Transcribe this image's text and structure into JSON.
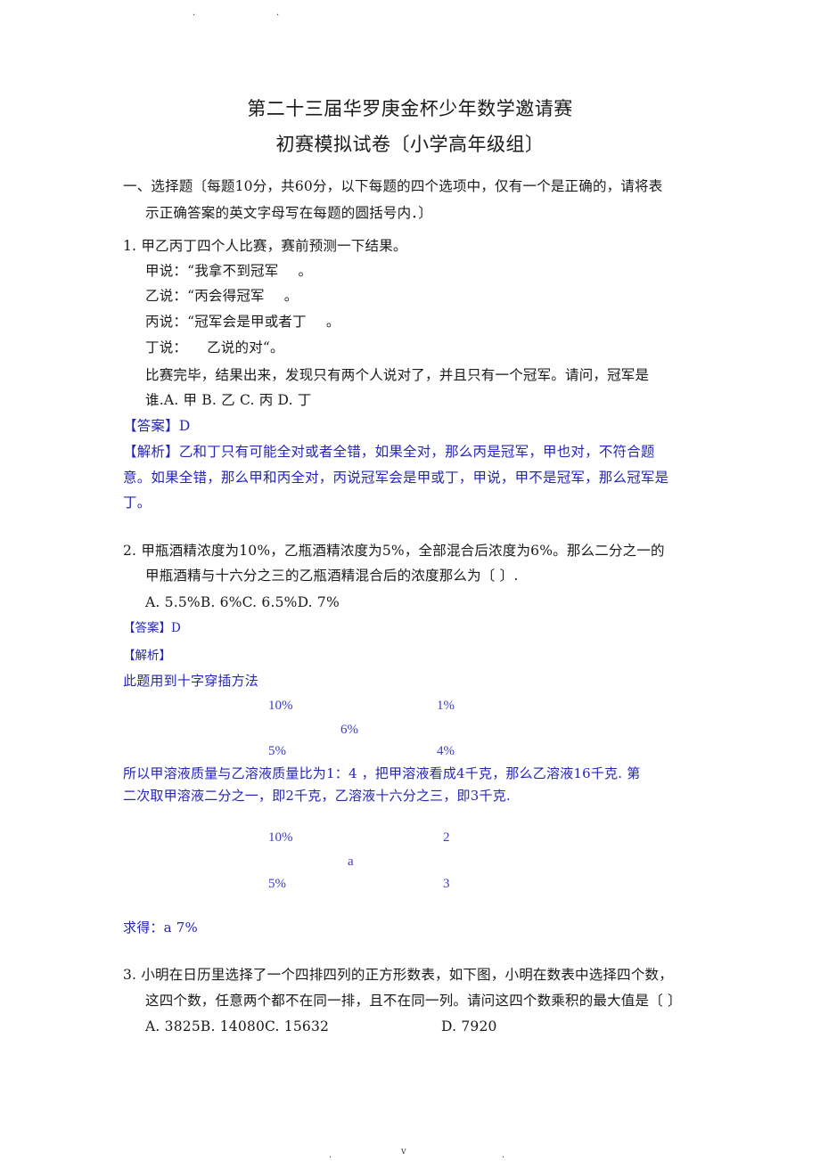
{
  "page_marks": {
    "top": [
      ".",
      "."
    ],
    "bottom": [
      ".",
      "v",
      "."
    ]
  },
  "header": {
    "title": "第二十三届华罗庚金杯少年数学邀请赛",
    "subtitle": "初赛模拟试卷〔小学高年级组〕"
  },
  "section": {
    "line1": "一、选择题〔每题10分，共60分，以下每题的四个选项中，仅有一个是正确的，请将表",
    "line2": "示正确答案的英文字母写在每题的圆括号内．〕"
  },
  "q1": {
    "stem": "1.  甲乙丙丁四个人比赛，赛前预测一下结果。",
    "statements": [
      {
        "speaker": "甲说：",
        "text": "“我拿不到冠军",
        "end": "。"
      },
      {
        "speaker": "乙说：",
        "text": "“丙会得冠军",
        "end": "。"
      },
      {
        "speaker": "丙说：",
        "text": "“冠军会是甲或者丁",
        "end": "。"
      },
      {
        "speaker": "丁说：",
        "text": "乙说的对“",
        "end": "。"
      }
    ],
    "question_line1": "比赛完毕，结果出来，发现只有两个人说对了，并且只有一个冠军。请问，冠军是",
    "question_line2": "谁.A.  甲 B.  乙 C.  丙 D.  丁",
    "answer_label": "【答案】",
    "answer_value": "D",
    "analysis_label": "【解析】",
    "analysis_line1": "乙和丁只有可能全对或者全错，如果全对，那么丙是冠军，甲也对，不符合题",
    "analysis_line2": "意。如果全错，那么甲和丙全对，丙说冠军会是甲或丁，甲说，甲不是冠军，那么冠军是",
    "analysis_line3": "丁。"
  },
  "q2": {
    "stem_line1": "2.  甲瓶酒精浓度为10%，乙瓶酒精浓度为5%，全部混合后浓度为6%。那么二分之一的",
    "stem_line2": "甲瓶酒精与十六分之三的乙瓶酒精混合后的浓度那么为〔  〕.",
    "options": "A.  5.5%B.  6%C.  6.5%D.  7%",
    "answer_label": "【答案】",
    "answer_value": "D",
    "analysis_label": "【解析】",
    "method": "此题用到十字穿插方法",
    "cross1": {
      "top_left": "10%",
      "top_right": "1%",
      "center": "6%",
      "bottom_left": "5%",
      "bottom_right": "4%"
    },
    "explain_line1": "所以甲溶液质量与乙溶液质量比为1：4    ，把甲溶液看成4千克，那么乙溶液16千克. 第",
    "explain_line2": "二次取甲溶液二分之一，即2千克，乙溶液十六分之三，即3千克.",
    "cross2": {
      "top_left": "10%",
      "top_right": "2",
      "center": "a",
      "bottom_left": "5%",
      "bottom_right": "3"
    },
    "result": "求得：a 7%"
  },
  "q3": {
    "stem_line1": "3.  小明在日历里选择了一个四排四列的正方形数表，如下图，小明在数表中选择四个数，",
    "stem_line2": "这四个数，任意两个都不在同一排，且不在同一列。请问这四个数乘积的最大值是〔  〕",
    "options_abc": "A.  3825B.  14080C.  15632",
    "option_d": "D.  7920"
  }
}
